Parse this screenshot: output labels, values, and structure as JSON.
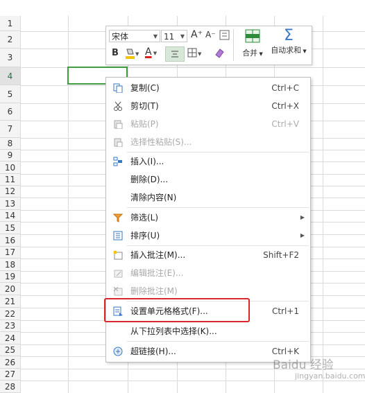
{
  "sheet": {
    "row_numbers": [
      "1",
      "2",
      "3",
      "4",
      "5",
      "6",
      "7",
      "8",
      "9",
      "10",
      "11",
      "12",
      "13",
      "14",
      "15",
      "16",
      "17",
      "18",
      "19",
      "20",
      "21",
      "22",
      "23",
      "24",
      "25",
      "26",
      "27",
      "28"
    ],
    "active_row": "4"
  },
  "mini_toolbar": {
    "font_name": "宋体",
    "font_size": "11",
    "grow_font": "A⁺",
    "shrink_font": "A⁻",
    "bold": "B",
    "font_color": "A",
    "merge_label": "合并",
    "autosum_label": "自动求和",
    "sigma": "Σ",
    "colors": {
      "fill": "#f5c400",
      "font": "#e02020",
      "merge": "#2e8b3c",
      "sum": "#3877c5"
    }
  },
  "menu": {
    "items": [
      {
        "label": "复制(C)",
        "shortcut": "Ctrl+C",
        "icon": "copy-icon",
        "enabled": true
      },
      {
        "label": "剪切(T)",
        "shortcut": "Ctrl+X",
        "icon": "scissors-icon",
        "enabled": true
      },
      {
        "label": "粘贴(P)",
        "shortcut": "Ctrl+V",
        "icon": "paste-icon",
        "enabled": false
      },
      {
        "label": "选择性粘贴(S)...",
        "shortcut": "",
        "icon": "paste-special-icon",
        "enabled": false
      },
      {
        "label": "插入(I)...",
        "shortcut": "",
        "icon": "insert-icon",
        "enabled": true
      },
      {
        "label": "删除(D)...",
        "shortcut": "",
        "icon": "",
        "enabled": true
      },
      {
        "label": "清除内容(N)",
        "shortcut": "",
        "icon": "",
        "enabled": true
      },
      {
        "label": "筛选(L)",
        "shortcut": "",
        "icon": "filter-icon",
        "enabled": true,
        "submenu": true
      },
      {
        "label": "排序(U)",
        "shortcut": "",
        "icon": "sort-icon",
        "enabled": true,
        "submenu": true
      },
      {
        "label": "插入批注(M)...",
        "shortcut": "Shift+F2",
        "icon": "insert-comment-icon",
        "enabled": true
      },
      {
        "label": "编辑批注(E)...",
        "shortcut": "",
        "icon": "edit-comment-icon",
        "enabled": false
      },
      {
        "label": "删除批注(M)",
        "shortcut": "",
        "icon": "delete-comment-icon",
        "enabled": false
      },
      {
        "label": "设置单元格格式(F)...",
        "shortcut": "Ctrl+1",
        "icon": "format-cells-icon",
        "enabled": true,
        "highlighted": true
      },
      {
        "label": "从下拉列表中选择(K)...",
        "shortcut": "",
        "icon": "",
        "enabled": true
      },
      {
        "label": "超链接(H)...",
        "shortcut": "Ctrl+K",
        "icon": "hyperlink-icon",
        "enabled": true
      }
    ]
  },
  "watermark": {
    "text": "Baidu 经验",
    "sub": "jingyan.baidu.com"
  }
}
